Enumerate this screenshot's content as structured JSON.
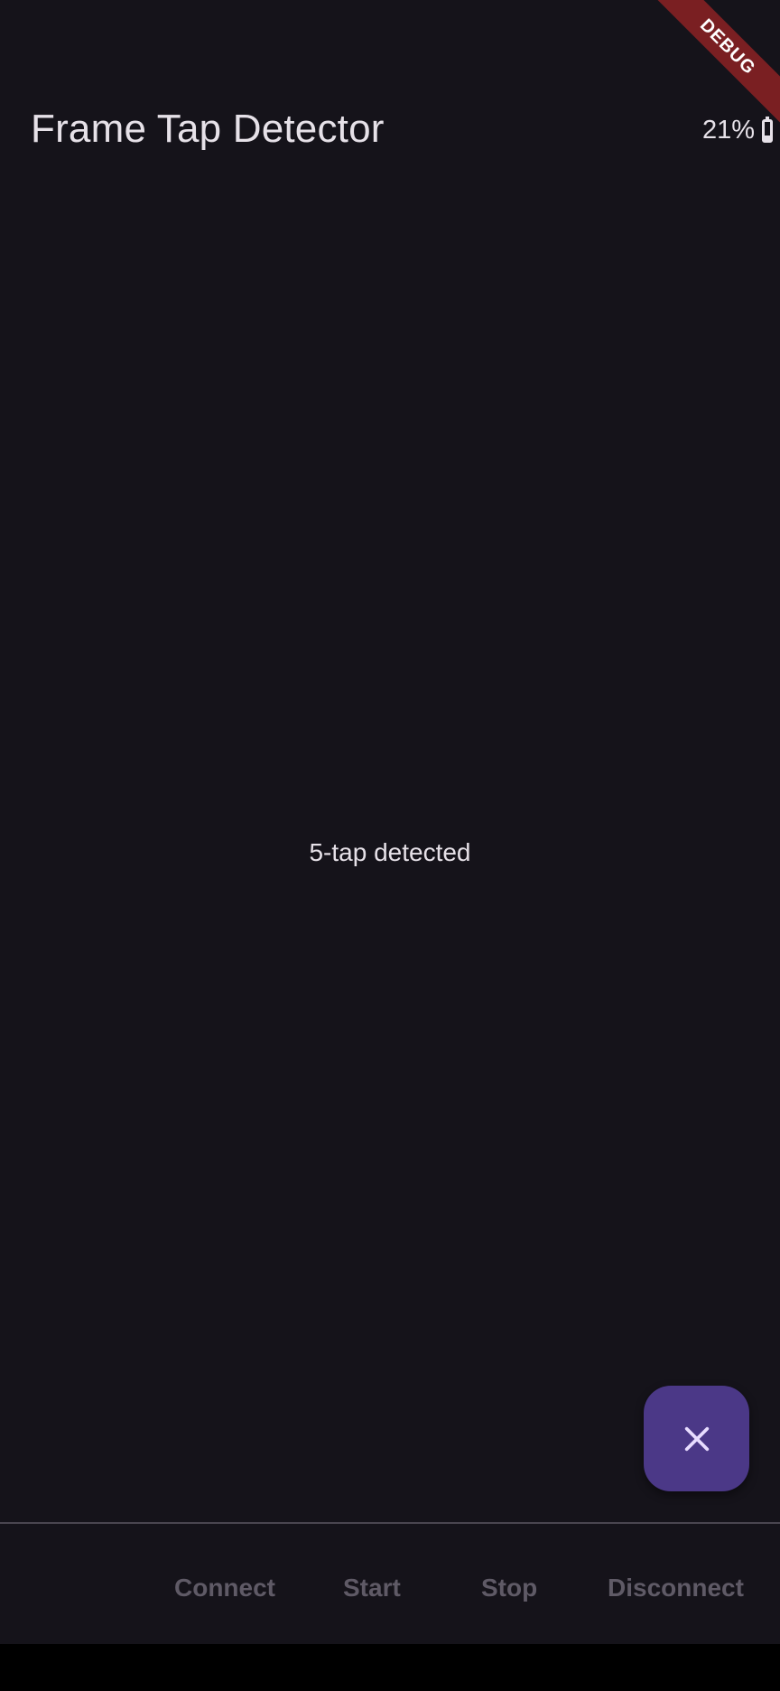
{
  "app": {
    "title": "Frame Tap Detector",
    "debug_label": "DEBUG"
  },
  "battery": {
    "percent_text": "21%",
    "level": 0.21,
    "icon": "battery-icon"
  },
  "main": {
    "status_text": "5-tap detected"
  },
  "fab": {
    "icon": "close-icon"
  },
  "bottom_bar": {
    "connect_label": "Connect",
    "start_label": "Start",
    "stop_label": "Stop",
    "disconnect_label": "Disconnect"
  },
  "colors": {
    "background": "#15131a",
    "text": "#e6e1e8",
    "fab": "#4b3887",
    "disabled_text": "#5f5a66",
    "debug_ribbon": "#7a1f22"
  }
}
